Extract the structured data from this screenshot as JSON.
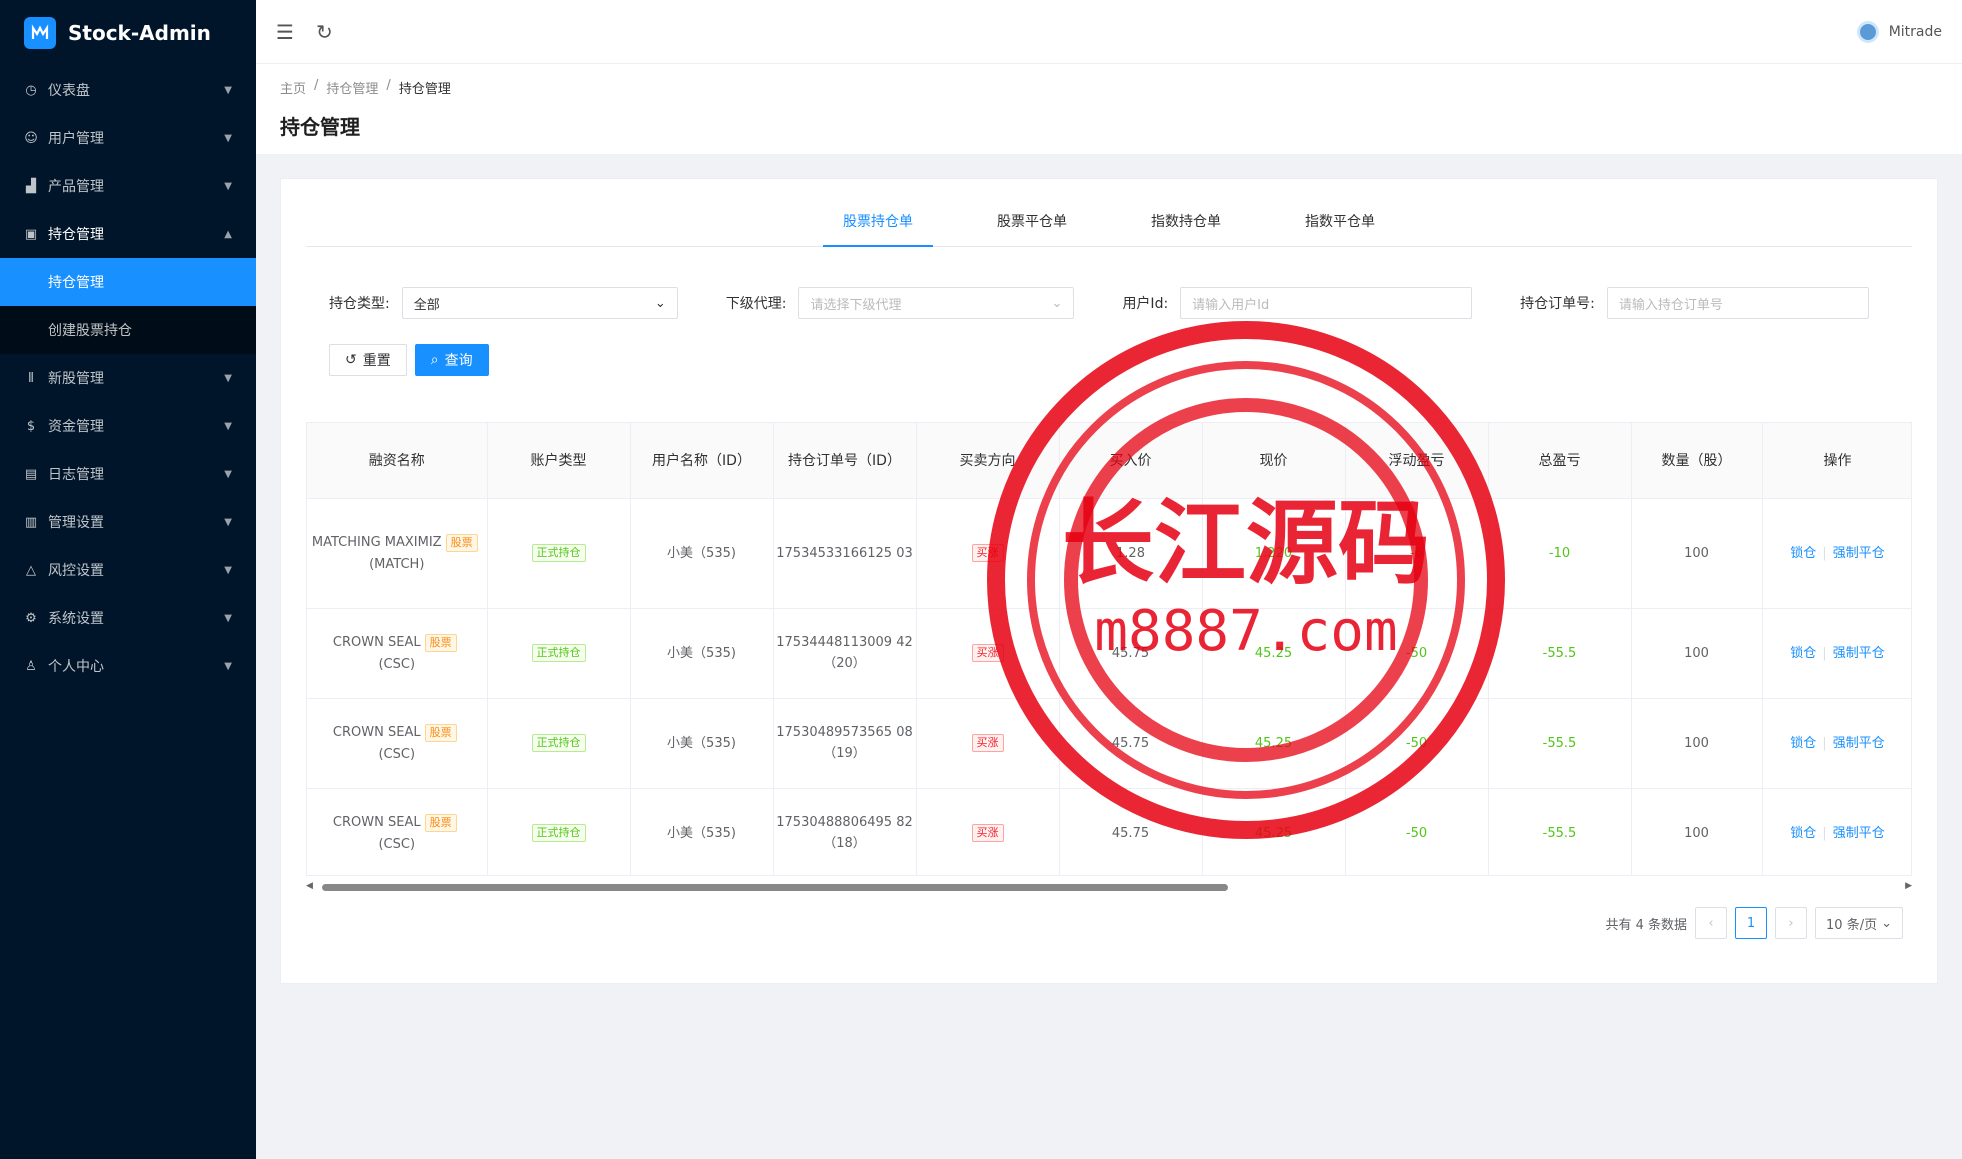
{
  "app": {
    "title": "Stock-Admin"
  },
  "sidebar": {
    "items": [
      {
        "label": "仪表盘",
        "icon": "dashboard-icon"
      },
      {
        "label": "用户管理",
        "icon": "users-icon"
      },
      {
        "label": "产品管理",
        "icon": "chart-icon"
      },
      {
        "label": "持仓管理",
        "icon": "position-icon",
        "open": true,
        "children": [
          {
            "label": "持仓管理",
            "active": true
          },
          {
            "label": "创建股票持仓"
          }
        ]
      },
      {
        "label": "新股管理",
        "icon": "ipo-icon"
      },
      {
        "label": "资金管理",
        "icon": "money-icon"
      },
      {
        "label": "日志管理",
        "icon": "log-icon"
      },
      {
        "label": "管理设置",
        "icon": "admin-settings-icon"
      },
      {
        "label": "风控设置",
        "icon": "warning-icon"
      },
      {
        "label": "系统设置",
        "icon": "gear-icon"
      },
      {
        "label": "个人中心",
        "icon": "user-icon"
      }
    ]
  },
  "header": {
    "username": "Mitrade"
  },
  "breadcrumb": [
    "主页",
    "持仓管理",
    "持仓管理"
  ],
  "page_title": "持仓管理",
  "tabs": [
    {
      "label": "股票持仓单",
      "active": true
    },
    {
      "label": "股票平仓单"
    },
    {
      "label": "指数持仓单"
    },
    {
      "label": "指数平仓单"
    }
  ],
  "filters": {
    "type_label": "持仓类型:",
    "type_value": "全部",
    "agent_label": "下级代理:",
    "agent_placeholder": "请选择下级代理",
    "userid_label": "用户Id:",
    "userid_placeholder": "请输入用户Id",
    "order_label": "持仓订单号:",
    "order_placeholder": "请输入持仓订单号",
    "reset_label": "重置",
    "query_label": "查询"
  },
  "table": {
    "columns": [
      "融资名称",
      "账户类型",
      "用户名称（ID）",
      "持仓订单号（ID）",
      "买卖方向",
      "买入价",
      "现价",
      "浮动盈亏",
      "总盈亏",
      "数量（股）",
      "操作"
    ],
    "rows": [
      {
        "name": "MATCHING MAXIMIZ",
        "tag": "股票",
        "code": "(MATCH)",
        "account": "正式持仓",
        "user": "小美（535)",
        "order": "17534533166125 03",
        "direction": "买涨",
        "buy_price": "1.28",
        "current": "1.220",
        "float_pl": "-6",
        "total_pl": "-10",
        "qty": "100"
      },
      {
        "name": "CROWN SEAL",
        "tag": "股票",
        "code": "(CSC)",
        "account": "正式持仓",
        "user": "小美（535)",
        "order": "17534448113009 42（20）",
        "direction": "买涨",
        "buy_price": "45.75",
        "current": "45.25",
        "float_pl": "-50",
        "total_pl": "-55.5",
        "qty": "100"
      },
      {
        "name": "CROWN SEAL",
        "tag": "股票",
        "code": "(CSC)",
        "account": "正式持仓",
        "user": "小美（535)",
        "order": "17530489573565 08（19）",
        "direction": "买涨",
        "buy_price": "45.75",
        "current": "45.25",
        "float_pl": "-50",
        "total_pl": "-55.5",
        "qty": "100"
      },
      {
        "name": "CROWN SEAL",
        "tag": "股票",
        "code": "(CSC)",
        "account": "正式持仓",
        "user": "小美（535)",
        "order": "17530488806495 82（18）",
        "direction": "买涨",
        "buy_price": "45.75",
        "current": "45.25",
        "float_pl": "-50",
        "total_pl": "-55.5",
        "qty": "100"
      }
    ],
    "actions": [
      "锁仓",
      "强制平仓"
    ]
  },
  "pagination": {
    "total_text": "共有 4 条数据",
    "current_page": "1",
    "page_size": "10 条/页"
  },
  "watermark": {
    "line1": "长江源码",
    "line2": "m8887.com"
  },
  "colors": {
    "sidebar": "#001529",
    "accent": "#1890ff",
    "profit_green": "#52c41a",
    "watermark_red": "#e60012"
  }
}
